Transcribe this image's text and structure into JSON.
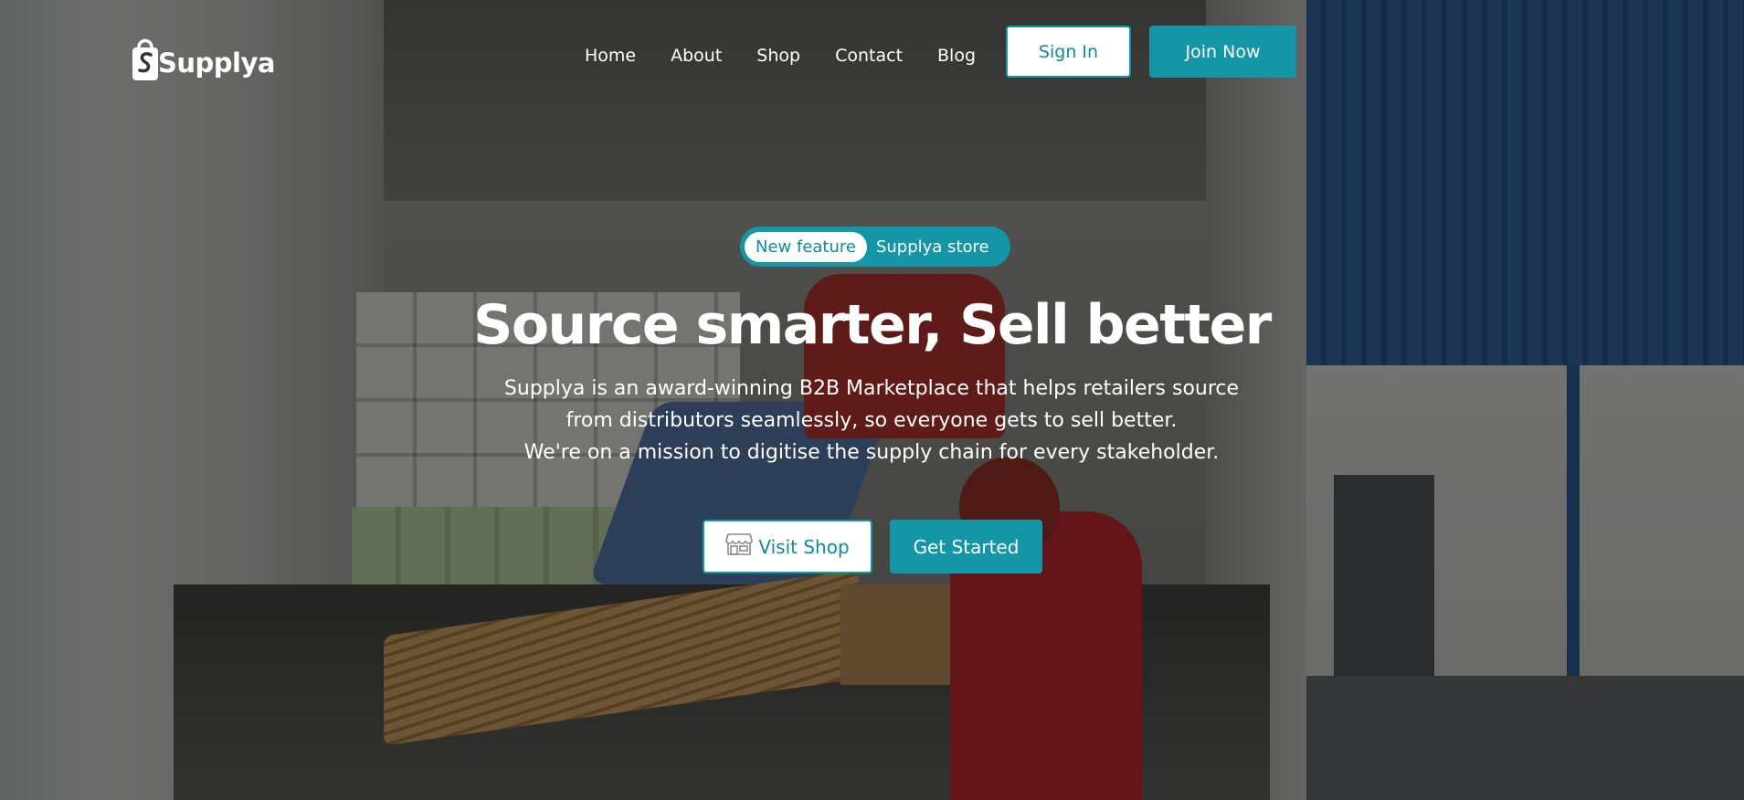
{
  "brand": {
    "name": "Supplya",
    "logo_icon": "shopping-bag-icon"
  },
  "nav": {
    "links": [
      "Home",
      "About",
      "Shop",
      "Contact",
      "Blog"
    ],
    "signin_label": "Sign In",
    "join_label": "Join Now"
  },
  "hero": {
    "badge": "New feature",
    "badge_text": "Supplya store",
    "headline": "Source smarter, Sell better",
    "description_lines": [
      "Supplya is an award-winning B2B Marketplace that helps retailers source",
      "from distributors seamlessly, so everyone gets to sell better.",
      "We're on a mission to digitise the supply chain for every stakeholder."
    ],
    "visit_shop_label": "Visit Shop",
    "visit_shop_icon": "storefront-icon",
    "get_started_label": "Get Started"
  },
  "colors": {
    "accent": "#1596a6",
    "text_light": "#ffffff"
  }
}
